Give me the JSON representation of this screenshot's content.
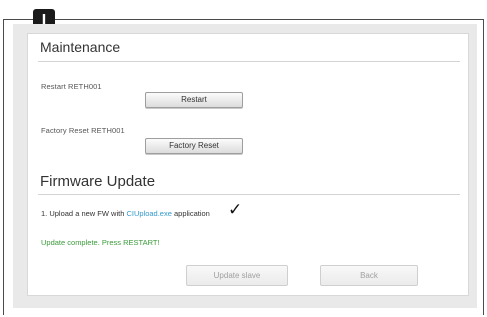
{
  "step_badge": "I",
  "maintenance": {
    "title": "Maintenance",
    "restart_label": "Restart RETH001",
    "restart_button": "Restart",
    "factory_label": "Factory Reset RETH001",
    "factory_button": "Factory Reset"
  },
  "firmware": {
    "title": "Firmware Update",
    "upload_prefix": "1. Upload a new FW with ",
    "upload_link": "CIUpload.exe",
    "upload_suffix": " application",
    "checkmark": "✓",
    "status_message": "Update complete. Press RESTART!",
    "update_slave_button": "Update slave",
    "back_button": "Back"
  },
  "colors": {
    "link": "#3399cc",
    "success": "#3a9a3a",
    "badge": "#1a1a1a"
  }
}
